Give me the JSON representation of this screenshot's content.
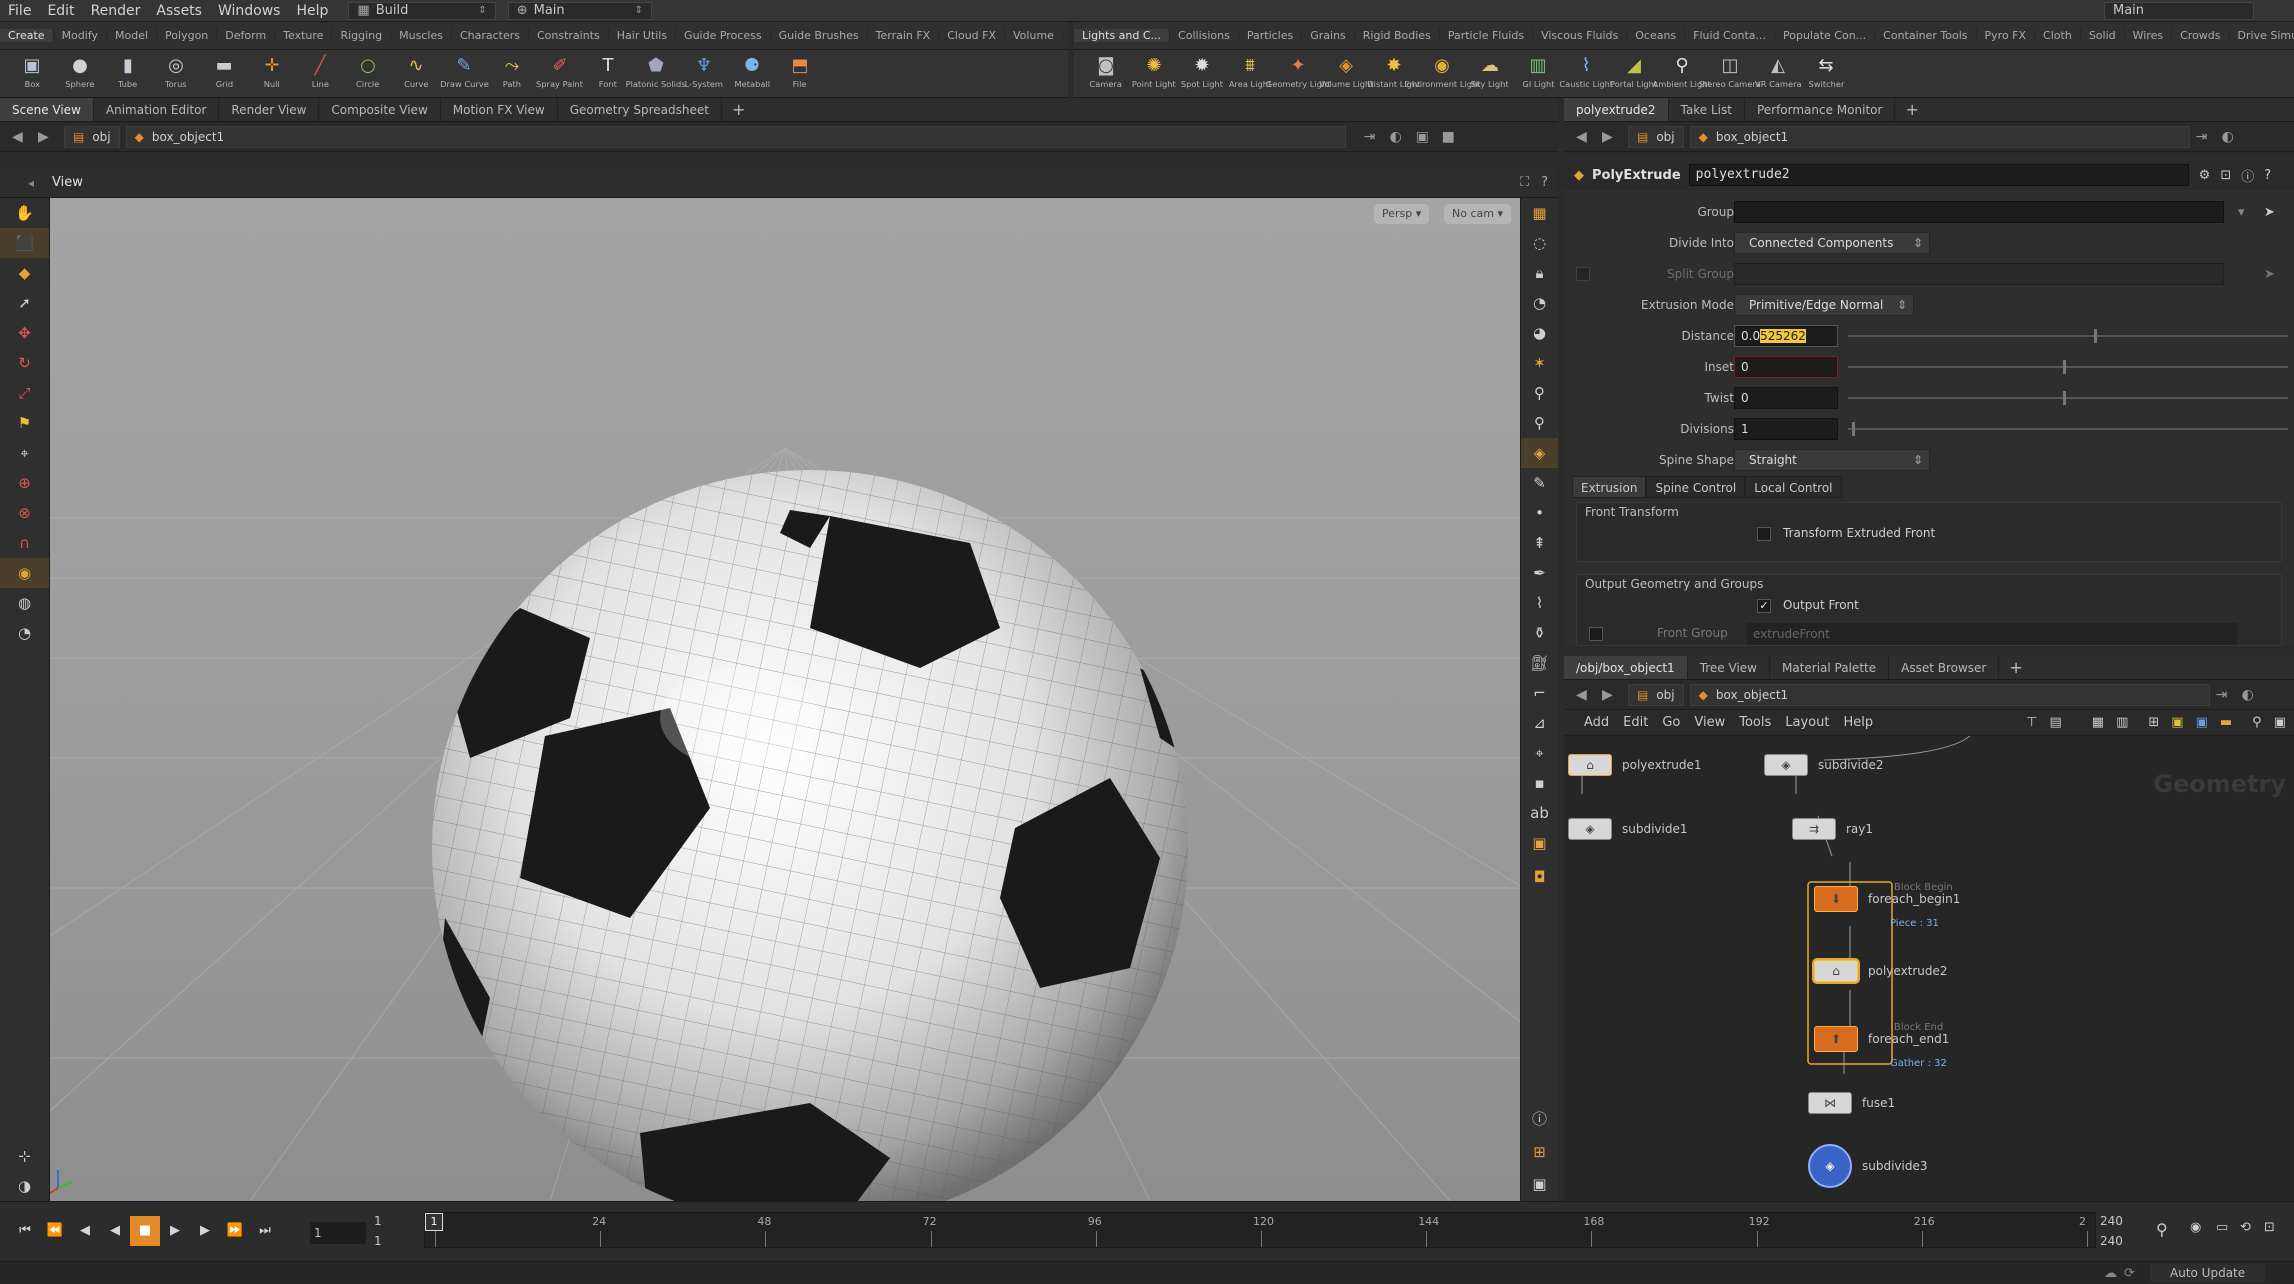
{
  "menubar": {
    "items": [
      "File",
      "Edit",
      "Render",
      "Assets",
      "Windows",
      "Help"
    ],
    "desktop_label": "Build",
    "main_label": "Main",
    "right_label": "Main"
  },
  "shelf_tabs_left": [
    "Create",
    "Modify",
    "Model",
    "Polygon",
    "Deform",
    "Texture",
    "Rigging",
    "Muscles",
    "Characters",
    "Constraints",
    "Hair Utils",
    "Guide Process",
    "Guide Brushes",
    "Terrain FX",
    "Cloud FX",
    "Volume"
  ],
  "shelf_tabs_right": [
    "Lights and C...",
    "Collisions",
    "Particles",
    "Grains",
    "Rigid Bodies",
    "Particle Fluids",
    "Viscous Fluids",
    "Oceans",
    "Fluid Conta...",
    "Populate Con...",
    "Container Tools",
    "Pyro FX",
    "Cloth",
    "Solid",
    "Wires",
    "Crowds",
    "Drive Simula..."
  ],
  "shelf_tools_left": [
    {
      "label": "Box",
      "icon": "box-icon",
      "glyph": "▣",
      "color": "#b9c3d1"
    },
    {
      "label": "Sphere",
      "icon": "sphere-icon",
      "glyph": "●",
      "color": "#d0d0d0"
    },
    {
      "label": "Tube",
      "icon": "tube-icon",
      "glyph": "▮",
      "color": "#c6cbd6"
    },
    {
      "label": "Torus",
      "icon": "torus-icon",
      "glyph": "◎",
      "color": "#c9cdd6"
    },
    {
      "label": "Grid",
      "icon": "grid-icon",
      "glyph": "▬",
      "color": "#c9cdd6"
    },
    {
      "label": "Null",
      "icon": "null-icon",
      "glyph": "✛",
      "color": "#e0903a"
    },
    {
      "label": "Line",
      "icon": "line-icon",
      "glyph": "╱",
      "color": "#d25050"
    },
    {
      "label": "Circle",
      "icon": "circle-icon",
      "glyph": "○",
      "color": "#86c06a"
    },
    {
      "label": "Curve",
      "icon": "curve-icon",
      "glyph": "∿",
      "color": "#e0c050"
    },
    {
      "label": "Draw Curve",
      "icon": "draw-curve-icon",
      "glyph": "✎",
      "color": "#7ea2e8"
    },
    {
      "label": "Path",
      "icon": "path-icon",
      "glyph": "⤳",
      "color": "#e0c050"
    },
    {
      "label": "Spray Paint",
      "icon": "spray-paint-icon",
      "glyph": "✐",
      "color": "#e86060"
    },
    {
      "label": "Font",
      "icon": "font-icon",
      "glyph": "T",
      "color": "#e0e0e0"
    },
    {
      "label": "Platonic Solids",
      "icon": "platonic-solids-icon",
      "glyph": "⬟",
      "color": "#a0a8b8"
    },
    {
      "label": "L-System",
      "icon": "l-system-icon",
      "glyph": "♆",
      "color": "#6a9ae0"
    },
    {
      "label": "Metaball",
      "icon": "metaball-icon",
      "glyph": "⚈",
      "color": "#8ab0e8"
    },
    {
      "label": "File",
      "icon": "file-icon",
      "glyph": "⬒",
      "color": "#e88a40"
    }
  ],
  "shelf_tools_right": [
    {
      "label": "Camera",
      "icon": "camera-icon",
      "glyph": "◙",
      "color": "#c0c0c0"
    },
    {
      "label": "Point Light",
      "icon": "point-light-icon",
      "glyph": "✺",
      "color": "#f0c040"
    },
    {
      "label": "Spot Light",
      "icon": "spot-light-icon",
      "glyph": "✹",
      "color": "#e0e0e0"
    },
    {
      "label": "Area Light",
      "icon": "area-light-icon",
      "glyph": "⩩",
      "color": "#e0c050"
    },
    {
      "label": "Geometry Light",
      "icon": "geometry-light-icon",
      "glyph": "✦",
      "color": "#e08040"
    },
    {
      "label": "Volume Light",
      "icon": "volume-light-icon",
      "glyph": "◈",
      "color": "#e09040"
    },
    {
      "label": "Distant Light",
      "icon": "distant-light-icon",
      "glyph": "✸",
      "color": "#f0c040"
    },
    {
      "label": "Environment Light",
      "icon": "environment-light-icon",
      "glyph": "◉",
      "color": "#e0b030"
    },
    {
      "label": "Sky Light",
      "icon": "sky-light-icon",
      "glyph": "☁",
      "color": "#e0c080"
    },
    {
      "label": "GI Light",
      "icon": "gi-light-icon",
      "glyph": "▥",
      "color": "#7ec07e"
    },
    {
      "label": "Caustic Light",
      "icon": "caustic-light-icon",
      "glyph": "⌇",
      "color": "#8fb0e8"
    },
    {
      "label": "Portal Light",
      "icon": "portal-light-icon",
      "glyph": "◢",
      "color": "#c0c050"
    },
    {
      "label": "Ambient Light",
      "icon": "ambient-light-icon",
      "glyph": "⚲",
      "color": "#e0e0e0"
    },
    {
      "label": "Stereo Camera",
      "icon": "stereo-camera-icon",
      "glyph": "◫",
      "color": "#c0c0c0"
    },
    {
      "label": "VR Camera",
      "icon": "vr-camera-icon",
      "glyph": "◭",
      "color": "#c0c0c0"
    },
    {
      "label": "Switcher",
      "icon": "switcher-icon",
      "glyph": "⇆",
      "color": "#e0e0e0"
    }
  ],
  "left_pane": {
    "tabs": [
      "Scene View",
      "Animation Editor",
      "Render View",
      "Composite View",
      "Motion FX View",
      "Geometry Spreadsheet"
    ],
    "path_obj": "obj",
    "path_node": "box_object1",
    "view_label": "View",
    "persp_button": "Persp",
    "cam_button": "No cam"
  },
  "params_pane": {
    "tabs": [
      "polyextrude2",
      "Take List",
      "Performance Monitor"
    ],
    "path_obj": "obj",
    "path_node": "box_object1",
    "node_type": "PolyExtrude",
    "node_name": "polyextrude2",
    "group_label": "Group",
    "group_value": "",
    "divide_into_label": "Divide Into",
    "divide_into_value": "Connected Components",
    "split_group_label": "Split Group",
    "extrusion_mode_label": "Extrusion Mode",
    "extrusion_mode_value": "Primitive/Edge Normal",
    "distance_label": "Distance",
    "distance_prefix": "0.0",
    "distance_selected": "525262",
    "distance_fill": 0.56,
    "inset_label": "Inset",
    "inset_value": "0",
    "twist_label": "Twist",
    "twist_value": "0",
    "divisions_label": "Divisions",
    "divisions_value": "1",
    "spine_shape_label": "Spine Shape",
    "spine_shape_value": "Straight",
    "subtabs": [
      "Extrusion",
      "Spine Control",
      "Local Control"
    ],
    "front_transform_label": "Front Transform",
    "transform_extruded_front": "Transform Extruded Front",
    "output_geo_label": "Output Geometry and Groups",
    "output_front": "Output Front",
    "front_group_label": "Front Group",
    "front_group_value": "extrudeFront"
  },
  "network_pane": {
    "tabs": [
      "/obj/box_object1",
      "Tree View",
      "Material Palette",
      "Asset Browser"
    ],
    "path_obj": "obj",
    "path_node": "box_object1",
    "menu": [
      "Add",
      "Edit",
      "Go",
      "View",
      "Tools",
      "Layout",
      "Help"
    ],
    "watermark": "Geometry",
    "nodes": {
      "polyextrude1": "polyextrude1",
      "subdivide1": "subdivide1",
      "subdivide2": "subdivide2",
      "ray1": "ray1",
      "foreach_begin1": "foreach_begin1",
      "block_begin": "Block Begin",
      "piece": "Piece : 31",
      "polyextrude2": "polyextrude2",
      "block_end": "Block End",
      "foreach_end1": "foreach_end1",
      "gather": "Gather : 32",
      "fuse1": "fuse1",
      "subdivide3": "subdivide3"
    }
  },
  "timeline": {
    "current_frame": "1",
    "start_frame": "1",
    "end_frame": "1",
    "range_end_top": "240",
    "range_end_bottom": "240",
    "ticks": [
      "1",
      "24",
      "48",
      "72",
      "96",
      "120",
      "144",
      "168",
      "192",
      "216",
      "2"
    ],
    "frame_marker": "1"
  },
  "status": {
    "auto_update": "Auto Update"
  }
}
